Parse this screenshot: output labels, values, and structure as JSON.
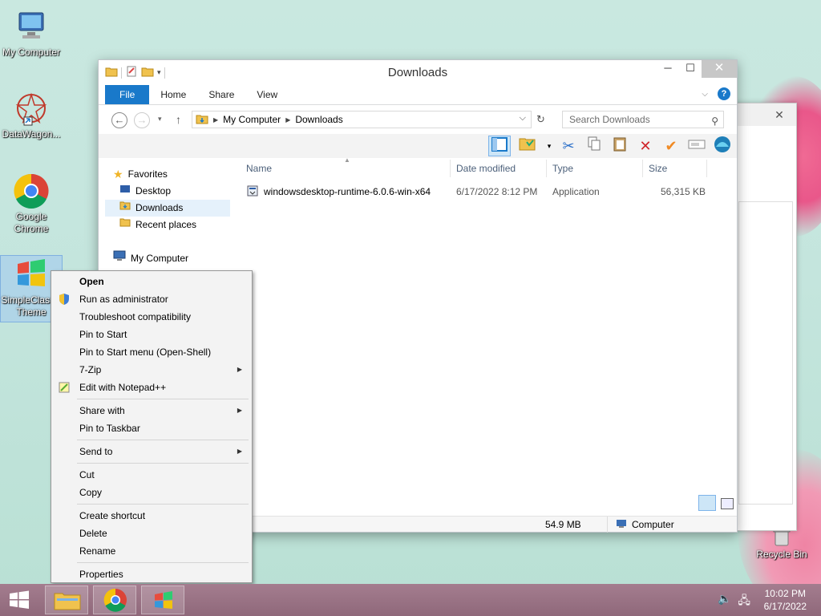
{
  "desktop": {
    "icons": [
      {
        "label": "My Computer"
      },
      {
        "label": "DataWagon..."
      },
      {
        "label": "Google Chrome"
      },
      {
        "label": "SimpleClassic Theme"
      },
      {
        "label": "Recycle Bin"
      }
    ]
  },
  "window": {
    "title": "Downloads",
    "ribbon_tabs": [
      "File",
      "Home",
      "Share",
      "View"
    ],
    "address": {
      "root": "My Computer",
      "current": "Downloads"
    },
    "search_placeholder": "Search Downloads",
    "nav": {
      "favorites": "Favorites",
      "desktop": "Desktop",
      "downloads": "Downloads",
      "recent": "Recent places",
      "computer": "My Computer"
    },
    "columns": [
      "Name",
      "Date modified",
      "Type",
      "Size"
    ],
    "files": [
      {
        "name": "windowsdesktop-runtime-6.0.6-win-x64",
        "date": "6/17/2022 8:12 PM",
        "type": "Application",
        "size": "56,315 KB"
      }
    ],
    "status": {
      "size": "54.9 MB",
      "location": "Computer"
    }
  },
  "context_menu": {
    "groups": [
      [
        "Open",
        "Run as administrator",
        "Troubleshoot compatibility",
        "Pin to Start",
        "Pin to Start menu (Open-Shell)",
        "7-Zip",
        "Edit with Notepad++"
      ],
      [
        "Share with",
        "Pin to Taskbar"
      ],
      [
        "Send to"
      ],
      [
        "Cut",
        "Copy"
      ],
      [
        "Create shortcut",
        "Delete",
        "Rename"
      ],
      [
        "Properties"
      ]
    ]
  },
  "taskbar": {
    "time": "10:02 PM",
    "date": "6/17/2022"
  }
}
